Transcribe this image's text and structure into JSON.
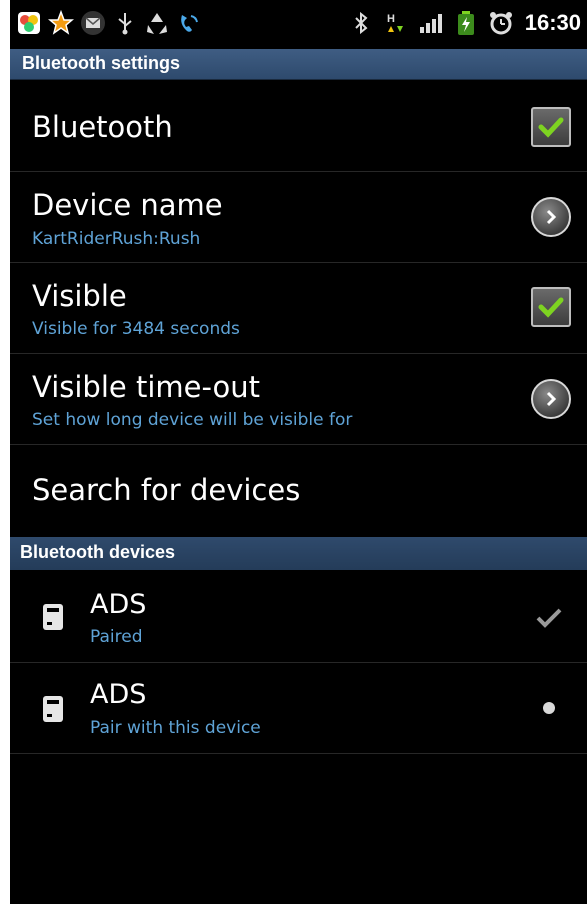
{
  "status_bar": {
    "time": "16:30",
    "left_icons": [
      "app-icon",
      "star-icon",
      "mail-icon",
      "usb-icon",
      "recycle-icon",
      "phone-call-icon"
    ],
    "right_icons": [
      "bluetooth-icon",
      "data-transfer-icon",
      "signal-icon",
      "battery-charging-icon",
      "alarm-icon"
    ]
  },
  "header": {
    "title": "Bluetooth settings"
  },
  "settings": {
    "bluetooth": {
      "label": "Bluetooth",
      "checked": true
    },
    "device_name": {
      "label": "Device name",
      "value": "KartRiderRush:Rush"
    },
    "visible": {
      "label": "Visible",
      "summary": "Visible for 3484 seconds",
      "checked": true
    },
    "visible_timeout": {
      "label": "Visible time-out",
      "summary": "Set how long device will be visible for"
    },
    "search": {
      "label": "Search for devices"
    }
  },
  "devices_section": {
    "title": "Bluetooth devices",
    "devices": [
      {
        "name": "ADS",
        "status": "Paired"
      },
      {
        "name": "ADS",
        "status": "Pair with this device"
      }
    ]
  },
  "colors": {
    "accent_blue": "#5fa3d6",
    "check_green": "#7ed321",
    "header_blue": "#3f5d83"
  }
}
